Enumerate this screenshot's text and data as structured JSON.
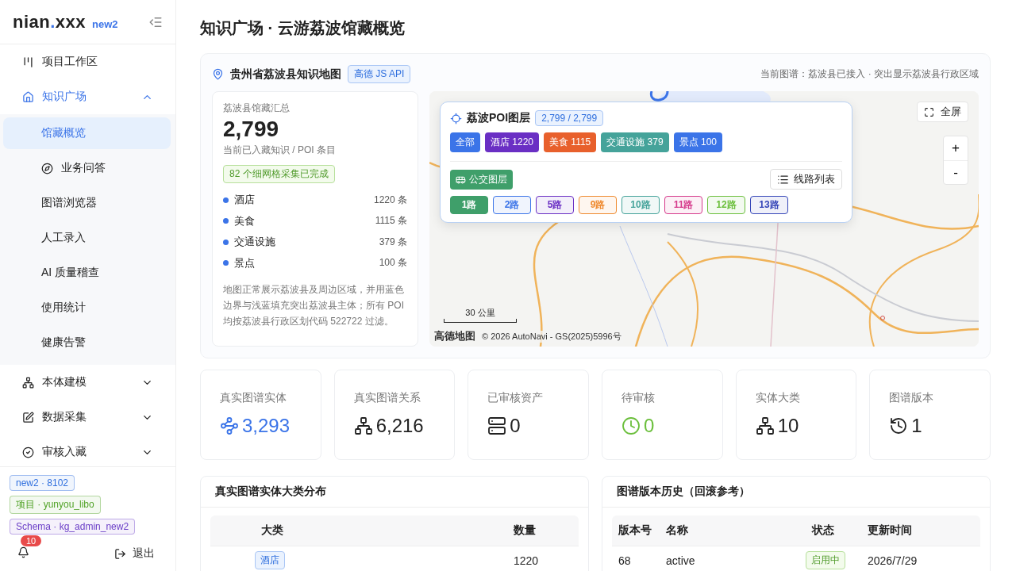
{
  "sidebar": {
    "logo": {
      "name": "nian",
      "dot": ".",
      "suffix": "xxx",
      "badge": "new2"
    },
    "items": [
      {
        "kind": "link",
        "label": "项目工作区",
        "selected": false
      },
      {
        "kind": "group",
        "label": "知识广场",
        "selected": true,
        "expanded": true,
        "children": [
          {
            "label": "馆藏概览",
            "selected": true
          },
          {
            "label": "业务问答",
            "selected": false
          },
          {
            "label": "图谱浏览器",
            "selected": false
          },
          {
            "label": "人工录入",
            "selected": false
          },
          {
            "label": "AI 质量稽查",
            "selected": false
          },
          {
            "label": "使用统计",
            "selected": false
          },
          {
            "label": "健康告警",
            "selected": false
          }
        ]
      },
      {
        "kind": "group",
        "label": "本体建模",
        "selected": false,
        "expanded": false
      },
      {
        "kind": "group",
        "label": "数据采集",
        "selected": false,
        "expanded": false
      },
      {
        "kind": "group",
        "label": "审核入藏",
        "selected": false,
        "expanded": false
      }
    ],
    "tags": [
      {
        "text": "new2 · 8102",
        "color": "#2f6fde"
      },
      {
        "text": "项目 · yunyou_libo",
        "color": "#52a329"
      },
      {
        "text": "Schema · kg_admin_new2",
        "color": "#6b3fc7"
      }
    ],
    "notifications": "10",
    "logout": "退出"
  },
  "page_title": "知识广场 · 云游荔波馆藏概览",
  "map_card": {
    "title": "贵州省荔波县知识地图",
    "badge": "高德 JS API",
    "status": "当前图谱：荔波县已接入 · 突出显示荔波县行政区域",
    "summary": {
      "title": "荔波县馆藏汇总",
      "total": "2,799",
      "subtitle": "当前已入藏知识 / POI 条目",
      "grid_note": "82 个细网格采集已完成",
      "categories": [
        {
          "name": "酒店",
          "count": "1220 条",
          "color": "#3b74e8"
        },
        {
          "name": "美食",
          "count": "1115 条",
          "color": "#3b74e8"
        },
        {
          "name": "交通设施",
          "count": "379 条",
          "color": "#3b74e8"
        },
        {
          "name": "景点",
          "count": "100 条",
          "color": "#3b74e8"
        }
      ],
      "note": "地图正常展示荔波县及周边区域，并用蓝色边界与浅蓝填充突出荔波县主体；所有 POI 均按荔波县行政区划代码 522722 过滤。"
    },
    "map": {
      "kind": "picture",
      "fullscreen": "全屏",
      "zoom_in": "+",
      "zoom_out": "-",
      "scale": "30 公里",
      "logo": "高德地图",
      "attribution": "© 2026 AutoNavi - GS(2025)5996号",
      "layer_panel": {
        "title": "荔波POI图层",
        "count": "2,799 / 2,799",
        "filters": [
          {
            "label": "全部",
            "color": "#3b74e8"
          },
          {
            "label": "酒店 1220",
            "color": "#6a2fc4"
          },
          {
            "label": "美食 1115",
            "color": "#e8602c"
          },
          {
            "label": "交通设施 379",
            "color": "#45a39a"
          },
          {
            "label": "景点 100",
            "color": "#3b74e8"
          }
        ],
        "bus_layer": "公交图层",
        "route_list": "线路列表",
        "routes": [
          {
            "label": "1路",
            "color": "#3f9f6a",
            "selected": true
          },
          {
            "label": "2路",
            "color": "#3b74e8",
            "selected": false
          },
          {
            "label": "5路",
            "color": "#6a2fc4",
            "selected": false
          },
          {
            "label": "9路",
            "color": "#ef8a2f",
            "selected": false
          },
          {
            "label": "10路",
            "color": "#45a39a",
            "selected": false
          },
          {
            "label": "11路",
            "color": "#d63a8c",
            "selected": false
          },
          {
            "label": "12路",
            "color": "#6bbf3c",
            "selected": false
          },
          {
            "label": "13路",
            "color": "#3546b8",
            "selected": false
          }
        ]
      }
    }
  },
  "stats": [
    {
      "label": "真实图谱实体",
      "value": "3,293",
      "color": "#3b74e8"
    },
    {
      "label": "真实图谱关系",
      "value": "6,216",
      "color": "#222222"
    },
    {
      "label": "已审核资产",
      "value": "0",
      "color": "#222222"
    },
    {
      "label": "待审核",
      "value": "0",
      "color": "#6bbf3c"
    },
    {
      "label": "实体大类",
      "value": "10",
      "color": "#222222"
    },
    {
      "label": "图谱版本",
      "value": "1",
      "color": "#222222"
    }
  ],
  "category_table": {
    "title": "真实图谱实体大类分布",
    "columns": [
      "大类",
      "数量"
    ],
    "rows": [
      {
        "category": "酒店",
        "count": "1220"
      }
    ]
  },
  "version_table": {
    "title": "图谱版本历史（回滚参考）",
    "columns": [
      "版本号",
      "名称",
      "状态",
      "更新时间"
    ],
    "rows": [
      {
        "version": "68",
        "name": "active",
        "status": "启用中",
        "active": true,
        "time": "2026/7/29"
      }
    ]
  }
}
